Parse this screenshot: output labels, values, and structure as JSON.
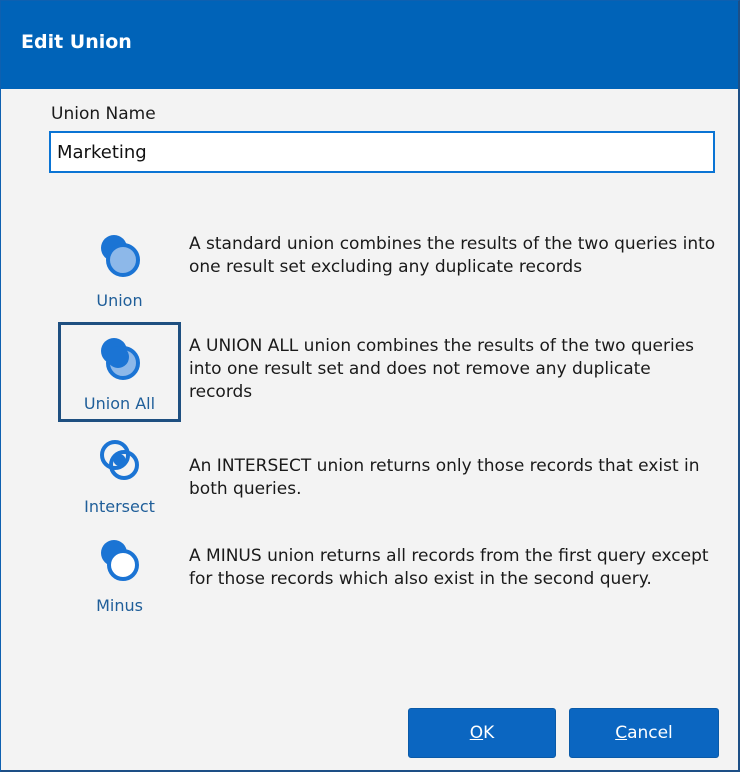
{
  "window": {
    "title": "Edit Union"
  },
  "union_name": {
    "label": "Union Name",
    "value": "Marketing"
  },
  "options": [
    {
      "label": "Union",
      "icon": "union-icon",
      "selected": false,
      "description": "A standard union combines the results of the two queries into one result set excluding any duplicate records"
    },
    {
      "label": "Union All",
      "icon": "union-all-icon",
      "selected": true,
      "description": "A UNION ALL union combines the results of the two queries into one result set and does not remove any duplicate records"
    },
    {
      "label": "Intersect",
      "icon": "intersect-icon",
      "selected": false,
      "description": "An INTERSECT union returns only those records that exist in both queries."
    },
    {
      "label": "Minus",
      "icon": "minus-icon",
      "selected": false,
      "description": "A MINUS union returns all records from the first query except for those records which also exist in the second query."
    }
  ],
  "buttons": {
    "ok": {
      "accel": "O",
      "rest": "K"
    },
    "cancel": {
      "accel": "C",
      "rest": "ancel"
    }
  },
  "colors": {
    "title_bar": "#0063b8",
    "accent": "#0b66c1",
    "icon_blue": "#1b74d4",
    "icon_light": "#8db8e9"
  }
}
